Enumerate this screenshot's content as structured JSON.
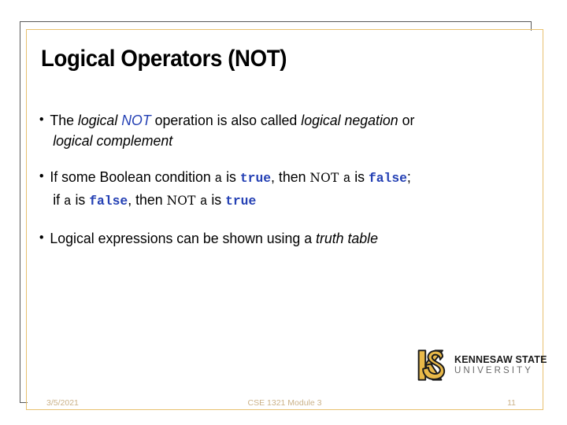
{
  "slide": {
    "title": "Logical Operators (NOT)",
    "bullet_marker": "•",
    "bullets": [
      {
        "id": "bullet-definition",
        "lines": [
          [
            {
              "text": "The ",
              "style": "plain"
            },
            {
              "text": "logical ",
              "style": "italic"
            },
            {
              "text": "NOT",
              "style": "blue-italic"
            },
            {
              "text": " operation is also called ",
              "style": "plain"
            },
            {
              "text": "logical negation",
              "style": "italic"
            },
            {
              "text": " or",
              "style": "plain"
            }
          ],
          [
            {
              "text": "logical complement",
              "style": "italic"
            }
          ]
        ]
      },
      {
        "id": "bullet-condition",
        "lines": [
          [
            {
              "text": "If some Boolean condition ",
              "style": "plain"
            },
            {
              "text": "a",
              "style": "code"
            },
            {
              "text": " is ",
              "style": "plain"
            },
            {
              "text": "true",
              "style": "code-keyword"
            },
            {
              "text": ", then ",
              "style": "plain"
            },
            {
              "text": "NOT ",
              "style": "code-serif"
            },
            {
              "text": " a",
              "style": "code"
            },
            {
              "text": " is ",
              "style": "plain"
            },
            {
              "text": "false",
              "style": "code-keyword"
            },
            {
              "text": ";",
              "style": "plain"
            }
          ],
          [
            {
              "text": "if ",
              "style": "plain"
            },
            {
              "text": "a",
              "style": "code"
            },
            {
              "text": " is ",
              "style": "plain"
            },
            {
              "text": "false",
              "style": "code-keyword"
            },
            {
              "text": ", then ",
              "style": "plain"
            },
            {
              "text": "NOT ",
              "style": "code-serif"
            },
            {
              "text": " a",
              "style": "code"
            },
            {
              "text": " is ",
              "style": "plain"
            },
            {
              "text": "true",
              "style": "code-keyword"
            }
          ]
        ]
      },
      {
        "id": "bullet-truth-table",
        "lines": [
          [
            {
              "text": "Logical expressions can be shown using a ",
              "style": "plain"
            },
            {
              "text": "truth table",
              "style": "italic"
            }
          ]
        ]
      }
    ]
  },
  "logo": {
    "name_top": "KENNESAW STATE",
    "name_bottom": "UNIVERSITY",
    "monogram_gold": "#E9B949",
    "monogram_outline": "#1a1a1a"
  },
  "footer": {
    "date": "3/5/2021",
    "course": "CSE 1321 Module 3",
    "page_number": "11"
  },
  "colors": {
    "frame_gray": "#595959",
    "frame_gold": "#E8C170",
    "keyword_blue": "#2440B4",
    "footer_text": "#CBB289",
    "background": "#FFFFFF"
  }
}
